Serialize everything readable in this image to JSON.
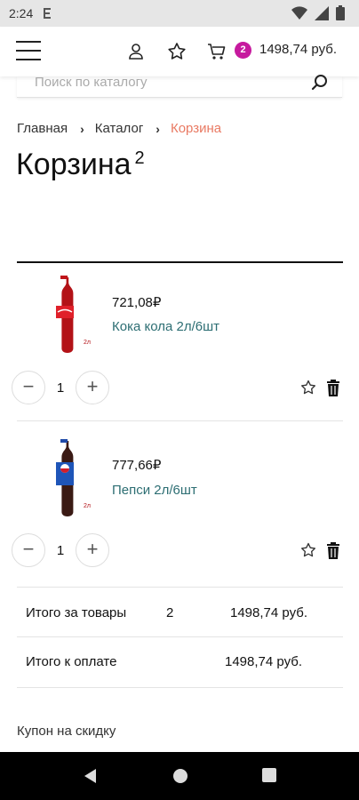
{
  "status_bar": {
    "time": "2:24"
  },
  "header": {
    "cart_count": "2",
    "cart_total": "1498,74 руб."
  },
  "search": {
    "placeholder": "Поиск по каталогу"
  },
  "breadcrumb": {
    "items": [
      "Главная",
      "Каталог"
    ],
    "current": "Корзина"
  },
  "page": {
    "title": "Корзина",
    "count": "2"
  },
  "cart": {
    "items": [
      {
        "price": "721,08₽",
        "name": "Кока кола 2л/6шт",
        "quantity": "1",
        "image_label": "2л"
      },
      {
        "price": "777,66₽",
        "name": "Пепси 2л/6шт",
        "quantity": "1",
        "image_label": "2л"
      }
    ]
  },
  "summary": {
    "goods_label": "Итого за товары",
    "goods_count": "2",
    "goods_total": "1498,74 руб.",
    "payment_label": "Итого к оплате",
    "payment_total": "1498,74 руб."
  },
  "coupon": {
    "label": "Купон на скидку"
  },
  "colors": {
    "accent": "#c61a9e",
    "breadcrumb_current": "#e97a63",
    "product_name": "#2d6e73"
  }
}
